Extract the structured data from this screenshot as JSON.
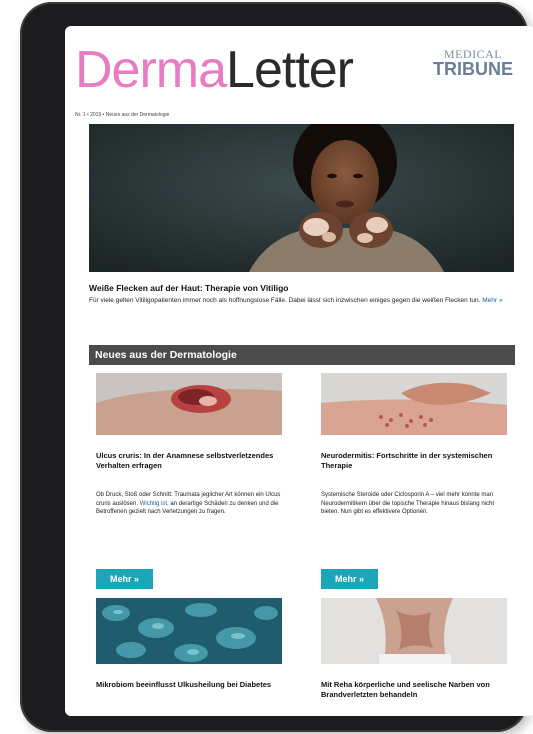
{
  "logo": {
    "part1": "Derma",
    "part2": "Letter"
  },
  "brand": {
    "line1": "MEDICAL",
    "line2": "TRIBUNE"
  },
  "issue_line": "Nr. 1 • 2019 • Neues aus der Dermatologie",
  "hero": {
    "headline": "Weiße Flecken auf der Haut: Therapie von Vitiligo",
    "teaser": "Für viele gelten Vitiligopatienten immer noch als hoffnungslose Fälle. Dabei lässt sich inzwischen einiges gegen die weißen Flecken tun.",
    "more_link": "Mehr »"
  },
  "section": {
    "title": "Neues aus der Dermatologie"
  },
  "articles": [
    {
      "title": "Ulcus cruris: In der Anamnese selbstverletzendes Verhalten erfragen",
      "text_a": "Ob Druck, Stoß oder Schnitt: Traumata jeglicher Art können ein Ulcus cruris auslösen.",
      "text_highlight": "Wichtig ist,",
      "text_b": "an derartige Schäden zu denken und die Betroffenen gezielt nach Verletzungen zu fragen.",
      "button": "Mehr »"
    },
    {
      "title": "Neurodermitis: Fortschritte in der systemischen Therapie",
      "text_a": "Systemische Steroide oder Ciclosporin A – viel mehr konnte man Neurodermitikern über die topische Therapie hinaus bislang nicht bieten. Nun gibt es effektivere Optionen.",
      "text_highlight": "",
      "text_b": "",
      "button": "Mehr »"
    },
    {
      "title": "Mikrobiom beeinflusst Ulkusheilung bei Diabetes"
    },
    {
      "title": "Mit Reha körperliche und seelische Narben von Brandverletzten behandeln"
    }
  ]
}
